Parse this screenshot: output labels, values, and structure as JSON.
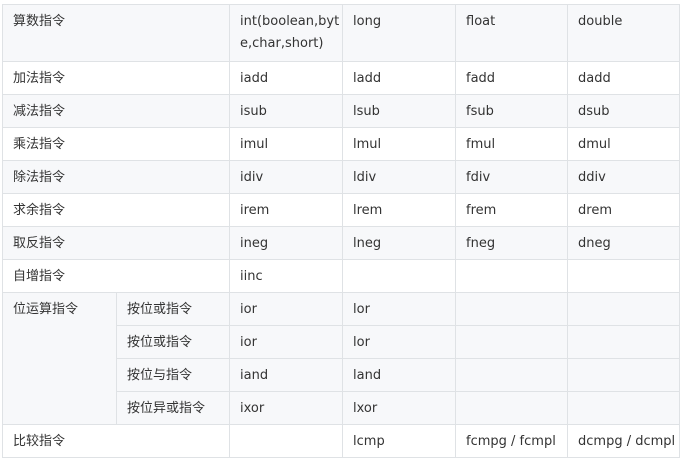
{
  "header": {
    "category": "算数指令",
    "int_types": "int(boolean,byte,char,short)",
    "long": "long",
    "float": "float",
    "double": "double"
  },
  "rows": [
    {
      "name": "加法指令",
      "int": "iadd",
      "long": "ladd",
      "float": "fadd",
      "double": "dadd"
    },
    {
      "name": "减法指令",
      "int": "isub",
      "long": "lsub",
      "float": "fsub",
      "double": "dsub"
    },
    {
      "name": "乘法指令",
      "int": "imul",
      "long": "lmul",
      "float": "fmul",
      "double": "dmul"
    },
    {
      "name": "除法指令",
      "int": "idiv",
      "long": "ldiv",
      "float": "fdiv",
      "double": "ddiv"
    },
    {
      "name": "求余指令",
      "int": "irem",
      "long": "lrem",
      "float": "frem",
      "double": "drem"
    },
    {
      "name": "取反指令",
      "int": "ineg",
      "long": "lneg",
      "float": "fneg",
      "double": "dneg"
    },
    {
      "name": "自增指令",
      "int": "iinc",
      "long": "",
      "float": "",
      "double": ""
    }
  ],
  "bitwise": {
    "group": "位运算指令",
    "rows": [
      {
        "sub": "按位或指令",
        "int": "ior",
        "long": "lor"
      },
      {
        "sub": "按位或指令",
        "int": "ior",
        "long": "lor"
      },
      {
        "sub": "按位与指令",
        "int": "iand",
        "long": "land"
      },
      {
        "sub": "按位异或指令",
        "int": "ixor",
        "long": "lxor"
      }
    ]
  },
  "compare": {
    "name": "比较指令",
    "int": "",
    "long": "lcmp",
    "float": "fcmpg / fcmpl",
    "double": "dcmpg / dcmpl"
  }
}
